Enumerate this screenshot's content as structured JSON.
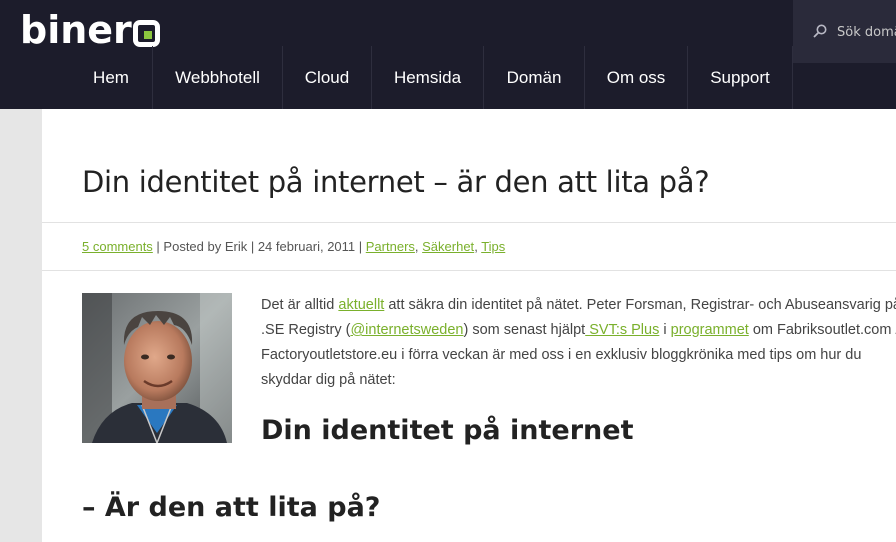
{
  "header": {
    "logo": "binero",
    "search_placeholder": "Sök domän"
  },
  "nav": {
    "items": [
      {
        "label": "Hem"
      },
      {
        "label": "Webbhotell"
      },
      {
        "label": "Cloud"
      },
      {
        "label": "Hemsida"
      },
      {
        "label": "Domän"
      },
      {
        "label": "Om oss"
      },
      {
        "label": "Support"
      }
    ]
  },
  "post": {
    "title": "Din identitet på internet – är den att lita på?",
    "meta": {
      "comments": "5 comments",
      "sep1": " | Posted by Erik | 24 februari, 2011 | ",
      "cat1": "Partners",
      "comma1": ", ",
      "cat2": "Säkerhet",
      "comma2": ", ",
      "cat3": "Tips"
    },
    "body": {
      "t1": "Det är alltid ",
      "l1": "aktuellt",
      "t2": " att säkra din identitet på nätet. Peter Forsman, Registrar- och Abuseansvarig på .SE Registry (",
      "l2": "@internetsweden",
      "t3": ") som senast hjälpt",
      "l3": " SVT:s Plus",
      "t4": " i ",
      "l4": "programmet",
      "t5": " om Fabriksoutlet.com / Factoryoutletstore.eu i förra veckan är med oss i en exklusiv bloggkrönika med tips om hur du skyddar dig på nätet:"
    },
    "subheading1": "Din identitet på internet",
    "subheading2": "– Är den att lita på?"
  }
}
